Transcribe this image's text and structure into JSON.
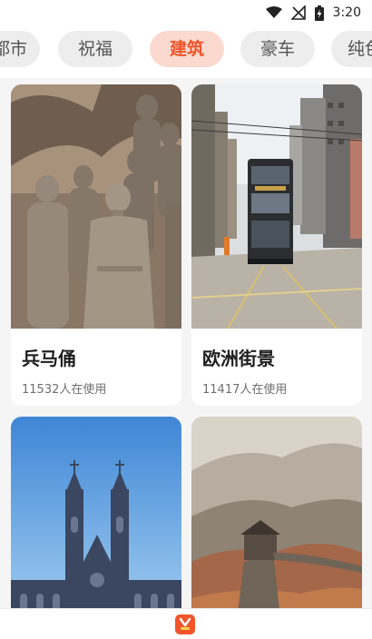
{
  "status_bar": {
    "time": "3:20",
    "icons": [
      "wifi-icon",
      "signal-off-icon",
      "battery-charging-icon"
    ]
  },
  "tabs": [
    {
      "label": "都市",
      "active": false
    },
    {
      "label": "祝福",
      "active": false
    },
    {
      "label": "建筑",
      "active": true
    },
    {
      "label": "豪车",
      "active": false
    },
    {
      "label": "纯色",
      "active": false
    }
  ],
  "cards": [
    {
      "title": "兵马俑",
      "usage": "11532人在使用",
      "image": "terracotta-warriors-photo"
    },
    {
      "title": "欧洲街景",
      "usage": "11417人在使用",
      "image": "european-street-tram-photo"
    },
    {
      "title": "",
      "usage": "",
      "image": "gothic-church-photo"
    },
    {
      "title": "",
      "usage": "",
      "image": "great-wall-photo"
    }
  ],
  "bottom_bar": {
    "icon": "app-home-icon"
  },
  "colors": {
    "accent": "#f2552c",
    "active_tab_bg": "#fbd9cf",
    "tab_bg": "#ededed",
    "page_bg": "#f5f5f5"
  }
}
